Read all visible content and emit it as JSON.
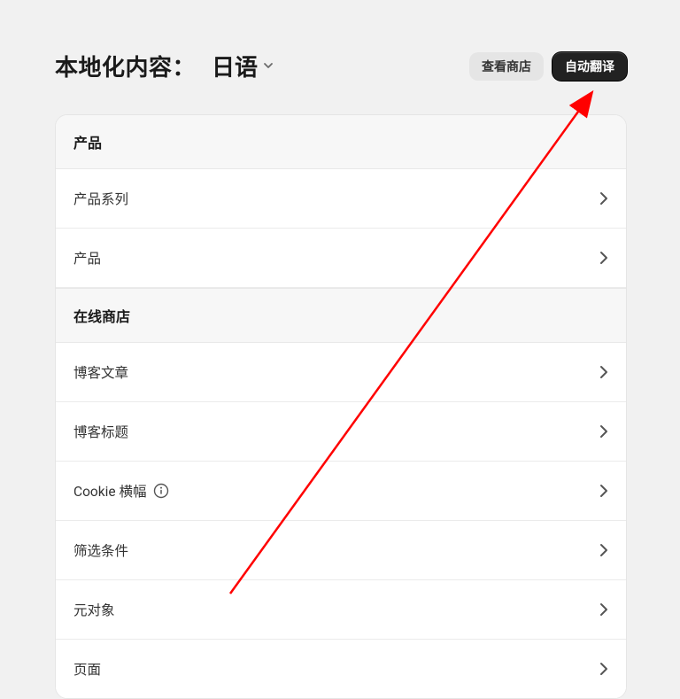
{
  "header": {
    "title": "本地化内容：",
    "language": "日语",
    "view_store": "查看商店",
    "auto_translate": "自动翻译"
  },
  "sections": [
    {
      "title": "产品",
      "items": [
        {
          "label": "产品系列",
          "info": false
        },
        {
          "label": "产品",
          "info": false
        }
      ]
    },
    {
      "title": "在线商店",
      "items": [
        {
          "label": "博客文章",
          "info": false
        },
        {
          "label": "博客标题",
          "info": false
        },
        {
          "label": "Cookie 横幅",
          "info": true
        },
        {
          "label": "筛选条件",
          "info": false
        },
        {
          "label": "元对象",
          "info": false
        },
        {
          "label": "页面",
          "info": false
        }
      ]
    }
  ],
  "annotation": {
    "arrow_color": "#ff0000"
  }
}
